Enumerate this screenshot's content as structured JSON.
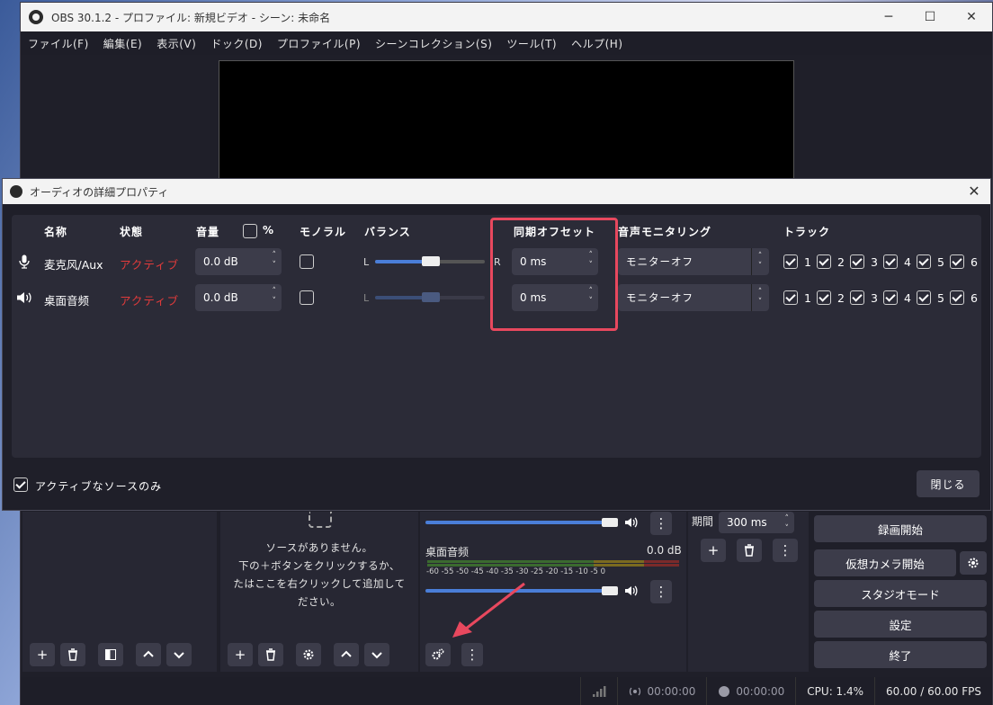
{
  "window": {
    "title": "OBS 30.1.2 - プロファイル: 新規ビデオ - シーン: 未命名",
    "controls": {
      "minimize": "─",
      "maximize": "☐",
      "close": "✕"
    }
  },
  "menu": [
    "ファイル(F)",
    "編集(E)",
    "表示(V)",
    "ドック(D)",
    "プロファイル(P)",
    "シーンコレクション(S)",
    "ツール(T)",
    "ヘルプ(H)"
  ],
  "dialog": {
    "title": "オーディオの詳細プロパティ",
    "headers": {
      "name": "名称",
      "status": "状態",
      "volume": "音量",
      "percent": "%",
      "mono": "モノラル",
      "balance": "バランス",
      "sync_offset": "同期オフセット",
      "monitoring": "音声モニタリング",
      "tracks": "トラック"
    },
    "balance_labels": {
      "left": "L",
      "right": "R"
    },
    "rows": [
      {
        "icon": "microphone-icon",
        "name": "麦克风/Aux",
        "status": "アクティブ",
        "volume": "0.0 dB",
        "mono": false,
        "sync_offset": "0 ms",
        "monitoring": "モニターオフ",
        "tracks": [
          "1",
          "2",
          "3",
          "4",
          "5",
          "6"
        ]
      },
      {
        "icon": "speaker-icon",
        "name": "桌面音频",
        "status": "アクティブ",
        "volume": "0.0 dB",
        "mono": false,
        "sync_offset": "0 ms",
        "monitoring": "モニターオフ",
        "tracks": [
          "1",
          "2",
          "3",
          "4",
          "5",
          "6"
        ]
      }
    ],
    "active_only_label": "アクティブなソースのみ",
    "close_label": "閉じる"
  },
  "sources": {
    "empty_line1": "ソースがありません。",
    "empty_line2": "下の＋ボタンをクリックするか、",
    "empty_line3": "たはここを右クリックして追加して",
    "empty_line4": "ださい。"
  },
  "mixer": {
    "channel_name": "桌面音频",
    "channel_db": "0.0 dB",
    "scale": "-60 -55 -50 -45 -40 -35 -30 -25 -20 -15 -10 -5 0"
  },
  "transitions": {
    "duration_label": "期間",
    "duration_value": "300 ms"
  },
  "controls": {
    "record": "録画開始",
    "virtual_cam": "仮想カメラ開始",
    "studio_mode": "スタジオモード",
    "settings": "設定",
    "exit": "終了"
  },
  "status": {
    "stream_time": "00:00:00",
    "record_time": "00:00:00",
    "cpu": "CPU: 1.4%",
    "fps": "60.00 / 60.00 FPS"
  },
  "colors": {
    "accent": "#4a7ed8",
    "active": "#e23b3b",
    "highlight": "#e8485e"
  }
}
